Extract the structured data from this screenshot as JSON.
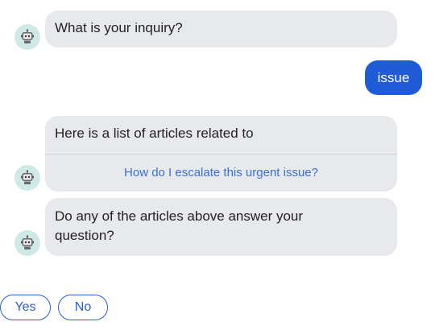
{
  "chat": {
    "messages": [
      {
        "sender": "bot",
        "text": "What is your inquiry?"
      },
      {
        "sender": "user",
        "text": "issue"
      },
      {
        "sender": "bot",
        "text": "Here is a list of articles related to",
        "articles": [
          "How do I escalate this urgent issue?"
        ]
      },
      {
        "sender": "bot",
        "text": "Do any of the articles above answer your question?"
      }
    ],
    "quick_replies": [
      "Yes",
      "No"
    ]
  },
  "colors": {
    "bot_bubble": "#e8e9ed",
    "user_bubble": "#1f5bd6",
    "avatar_bg": "#cfe9e7",
    "link": "#3a6fd8",
    "accent": "#2a5fd0"
  },
  "icons": {
    "avatar": "robot-icon"
  }
}
